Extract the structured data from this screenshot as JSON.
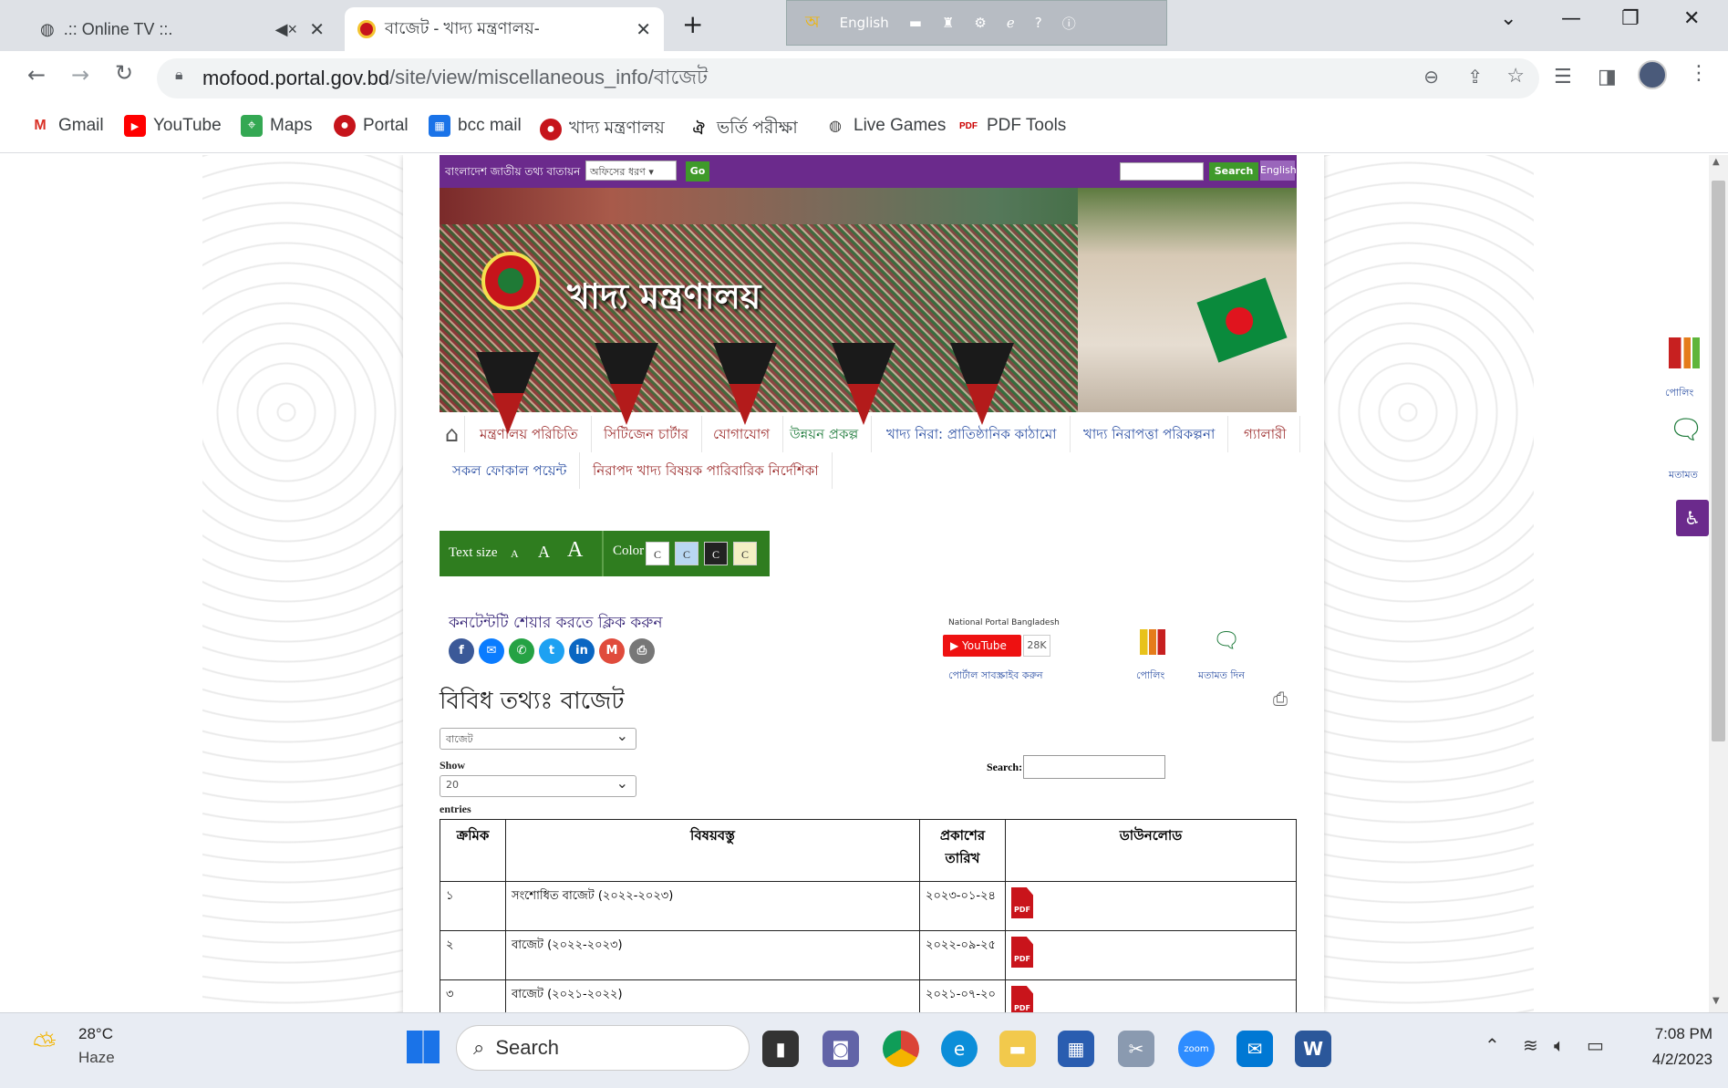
{
  "browser": {
    "tabs": [
      {
        "title": ".:: Online TV ::.",
        "active": false
      },
      {
        "title": "বাজেট - খাদ্য মন্ত্রণালয়-",
        "active": true
      }
    ],
    "ime_label": "English",
    "url_host": "mofood.portal.gov.bd",
    "url_path": "/site/view/miscellaneous_info/বাজেট",
    "bookmarks": [
      "Gmail",
      "YouTube",
      "Maps",
      "Portal",
      "bcc mail",
      "খাদ্য মন্ত্রণালয়",
      "ভর্তি পরীক্ষা",
      "Live Games",
      "PDF Tools"
    ]
  },
  "site": {
    "topbar_label": "বাংলাদেশ জাতীয় তথ্য বাতায়ন",
    "office_type_placeholder": "অফিসের ধরণ",
    "go": "Go",
    "search_btn": "Search",
    "english_btn": "English",
    "banner_title": "খাদ্য মন্ত্রণালয়",
    "menu": [
      "মন্ত্রণালয় পরিচিতি",
      "সিটিজেন চার্টার",
      "যোগাযোগ",
      "উন্নয়ন প্রকল্প",
      "খাদ্য নিরা: প্রাতিষ্ঠানিক কাঠামো",
      "খাদ্য নিরাপত্তা পরিকল্পনা",
      "গ্যালারী",
      "সকল ফোকাল পয়েন্ট",
      "নিরাপদ খাদ্য বিষয়ক পারিবারিক নির্দেশিকা"
    ],
    "text_size_label": "Text size",
    "text_sizes": [
      "A",
      "A",
      "A"
    ],
    "color_label": "Color",
    "color_boxes": [
      "C",
      "C",
      "C",
      "C"
    ],
    "share_label": "কনটেন্টটি শেয়ার করতে ক্লিক করুন",
    "np_label": "National Portal Bangladesh",
    "youtube": "YouTube",
    "yt_count": "28K",
    "subscribe": "পোর্টাল সাবস্ক্রাইব করুন",
    "polling": "পোলিং",
    "feedback": "মতামত দিন",
    "side_polling": "পোলিং",
    "side_feedback": "মতামত",
    "page_title": "বিবিধ তথ্যঃ বাজেট",
    "category_select": "বাজেট",
    "show_label": "Show",
    "entries_select": "20",
    "entries_label": "entries",
    "search_label": "Search:",
    "table_headers": [
      "ক্রমিক",
      "বিষয়বস্তু",
      "প্রকাশের তারিখ",
      "ডাউনলোড"
    ],
    "rows": [
      {
        "serial": "১",
        "subject": "সংশোধিত বাজেট (২০২২-২০২৩)",
        "date": "২০২৩-০১-২৪"
      },
      {
        "serial": "২",
        "subject": "বাজেট (২০২২-২০২৩)",
        "date": "২০২২-০৯-২৫"
      },
      {
        "serial": "৩",
        "subject": "বাজেট (২০২১-২০২২)",
        "date": "২০২১-০৭-২০"
      }
    ],
    "pdf": "PDF"
  },
  "taskbar": {
    "temp": "28°C",
    "weather": "Haze",
    "search": "Search",
    "time": "7:08 PM",
    "date": "4/2/2023"
  }
}
